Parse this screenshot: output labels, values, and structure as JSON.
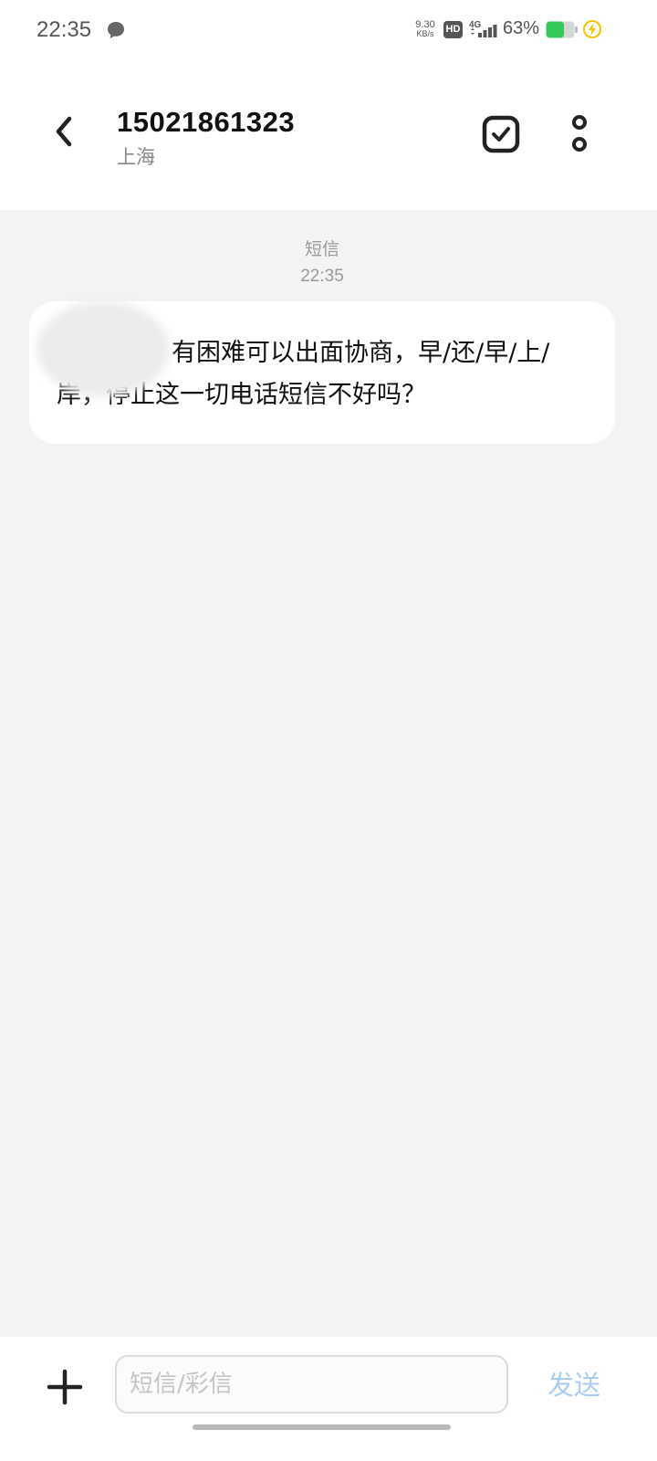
{
  "status_bar": {
    "time": "22:35",
    "net_speed_value": "9.30",
    "net_speed_unit": "KB/s",
    "hd_label": "HD",
    "network_type": "4G",
    "battery_percent": "63%",
    "battery_level": 0.63,
    "icons": [
      "message-notification-icon",
      "hd-icon",
      "signal-4g-icon",
      "battery-icon",
      "charging-icon"
    ],
    "colors": {
      "battery": "#34c759",
      "charging": "#f5c400"
    }
  },
  "header": {
    "contact_number": "15021861323",
    "contact_location": "上海",
    "icons": [
      "back-arrow-icon",
      "checkbox-select-icon",
      "more-vertical-icon"
    ]
  },
  "conversation": {
    "message_type": "短信",
    "message_time": "22:35",
    "messages": [
      {
        "direction": "incoming",
        "text": "有困难可以出面协商，早/还/早/上/岸，停止这一切电话短信不好吗？"
      }
    ]
  },
  "input_bar": {
    "placeholder": "短信/彩信",
    "value": "",
    "send_label": "发送",
    "icons": [
      "plus-icon"
    ],
    "colors": {
      "send_disabled": "#a9cdf2"
    }
  }
}
